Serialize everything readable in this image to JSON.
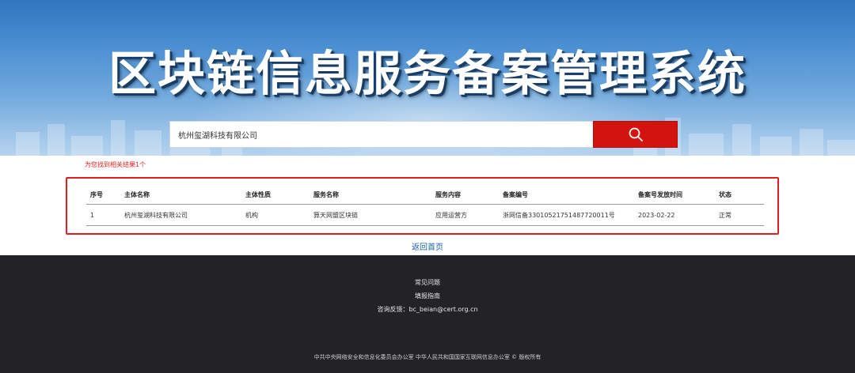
{
  "banner": {
    "title": "区块链信息服务备案管理系统"
  },
  "search": {
    "value": "杭州玺湖科技有限公司",
    "placeholder": ""
  },
  "results": {
    "count_text": "为您找到相关结果1个",
    "columns": [
      "序号",
      "主体名称",
      "主体性质",
      "服务名称",
      "服务内容",
      "备案编号",
      "备案号发放时间",
      "状态"
    ],
    "rows": [
      [
        "1",
        "杭州玺湖科技有限公司",
        "机构",
        "算天网盟区块链",
        "应用运营方",
        "浙网信备33010521751487720011号",
        "2023-02-22",
        "正常"
      ]
    ]
  },
  "back_home": "返回首页",
  "footer": {
    "faq": "常见问题",
    "guide": "填报指南",
    "contact": "咨询反馈：bc_beian@cert.org.cn",
    "copyright": "中共中央网络安全和信息化委员会办公室   中华人民共和国国家互联网信息办公室 © 版权所有"
  },
  "colors": {
    "accent_red": "#d3130d",
    "frame_red": "#e02020",
    "link_blue": "#1a5fa8",
    "footer_bg": "#232226"
  },
  "icons": {
    "search": "search-icon"
  }
}
